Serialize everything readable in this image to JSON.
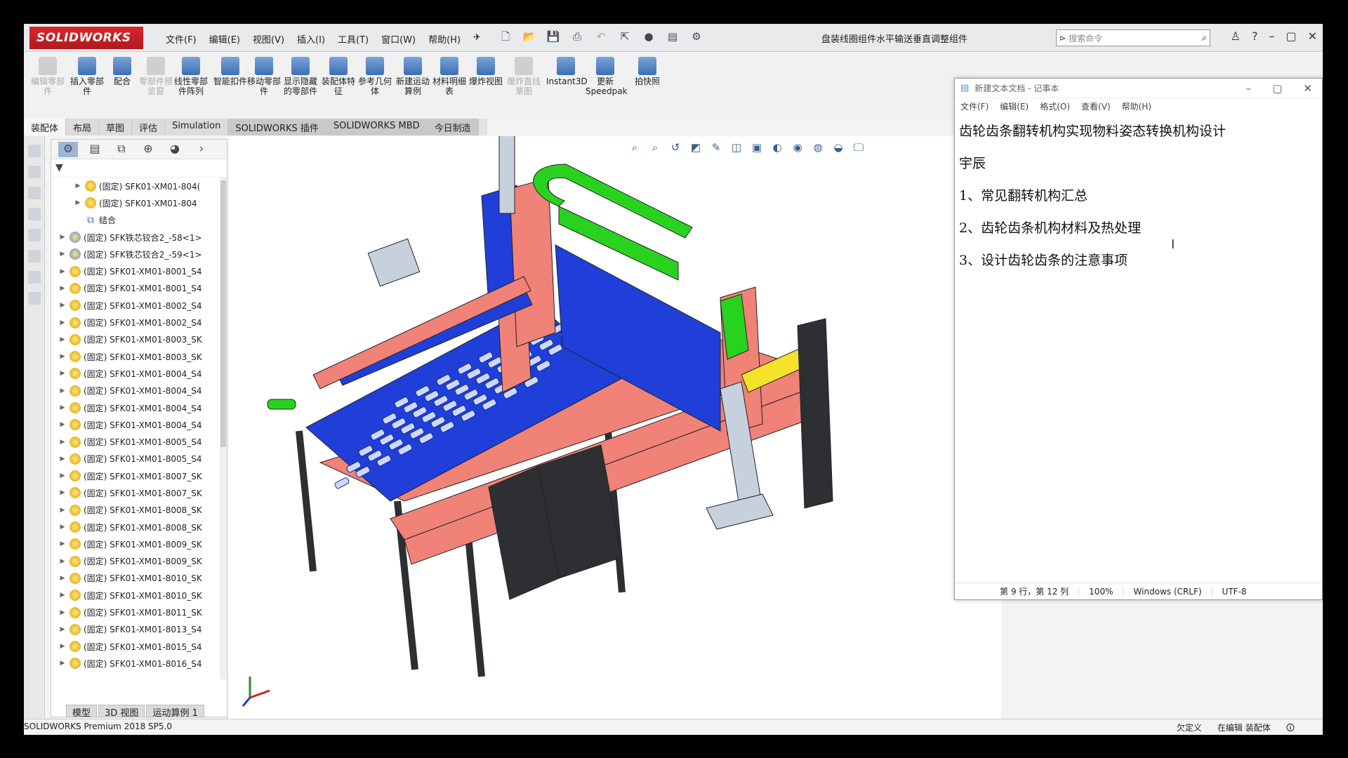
{
  "titlebar": {
    "brand": "SOLIDWORKS",
    "menu": [
      "文件(F)",
      "编辑(E)",
      "视图(V)",
      "插入(I)",
      "工具(T)",
      "窗口(W)",
      "帮助(H)"
    ],
    "document_title": "盘装线圈组件水平输送垂直调整组件",
    "search_placeholder": "搜索命令"
  },
  "commands": [
    {
      "label": "编辑零部件",
      "enabled": false
    },
    {
      "label": "插入零部件",
      "enabled": true
    },
    {
      "label": "配合",
      "enabled": true
    },
    {
      "label": "零部件预览窗",
      "enabled": false
    },
    {
      "label": "线性零部件阵列",
      "enabled": true
    },
    {
      "label": "智能扣件",
      "enabled": true
    },
    {
      "label": "移动零部件",
      "enabled": true
    },
    {
      "label": "显示隐藏的零部件",
      "enabled": true
    },
    {
      "label": "装配体特征",
      "enabled": true
    },
    {
      "label": "参考几何体",
      "enabled": true
    },
    {
      "label": "新建运动算例",
      "enabled": true
    },
    {
      "label": "材料明细表",
      "enabled": true
    },
    {
      "label": "爆炸视图",
      "enabled": true
    },
    {
      "label": "爆炸直线草图",
      "enabled": false
    },
    {
      "label": "Instant3D",
      "enabled": true
    },
    {
      "label": "更新Speedpak",
      "enabled": true
    },
    {
      "label": "拍快照",
      "enabled": true
    }
  ],
  "tabs": [
    "装配体",
    "布局",
    "草图",
    "评估",
    "Simulation",
    "SOLIDWORKS 插件",
    "SOLIDWORKS MBD",
    "今日制造"
  ],
  "tree": [
    {
      "label": "(固定) SFK01-XM01-804(",
      "indent": 2,
      "type": "part"
    },
    {
      "label": "(固定) SFK01-XM01-804",
      "indent": 2,
      "type": "part"
    },
    {
      "label": "结合",
      "indent": 2,
      "type": "mate"
    },
    {
      "label": "(固定) SFK铁芯铰合2_-58<1>",
      "indent": 1,
      "type": "asm"
    },
    {
      "label": "(固定) SFK铁芯铰合2_-59<1>",
      "indent": 1,
      "type": "asm"
    },
    {
      "label": "(固定) SFK01-XM01-8001_S4",
      "indent": 1,
      "type": "part"
    },
    {
      "label": "(固定) SFK01-XM01-8001_S4",
      "indent": 1,
      "type": "part"
    },
    {
      "label": "(固定) SFK01-XM01-8002_S4",
      "indent": 1,
      "type": "part"
    },
    {
      "label": "(固定) SFK01-XM01-8002_S4",
      "indent": 1,
      "type": "part"
    },
    {
      "label": "(固定) SFK01-XM01-8003_SK",
      "indent": 1,
      "type": "part"
    },
    {
      "label": "(固定) SFK01-XM01-8003_SK",
      "indent": 1,
      "type": "part"
    },
    {
      "label": "(固定) SFK01-XM01-8004_S4",
      "indent": 1,
      "type": "part"
    },
    {
      "label": "(固定) SFK01-XM01-8004_S4",
      "indent": 1,
      "type": "part"
    },
    {
      "label": "(固定) SFK01-XM01-8004_S4",
      "indent": 1,
      "type": "part"
    },
    {
      "label": "(固定) SFK01-XM01-8004_S4",
      "indent": 1,
      "type": "part"
    },
    {
      "label": "(固定) SFK01-XM01-8005_S4",
      "indent": 1,
      "type": "part"
    },
    {
      "label": "(固定) SFK01-XM01-8005_S4",
      "indent": 1,
      "type": "part"
    },
    {
      "label": "(固定) SFK01-XM01-8007_SK",
      "indent": 1,
      "type": "part"
    },
    {
      "label": "(固定) SFK01-XM01-8007_SK",
      "indent": 1,
      "type": "part"
    },
    {
      "label": "(固定) SFK01-XM01-8008_SK",
      "indent": 1,
      "type": "part"
    },
    {
      "label": "(固定) SFK01-XM01-8008_SK",
      "indent": 1,
      "type": "part"
    },
    {
      "label": "(固定) SFK01-XM01-8009_SK",
      "indent": 1,
      "type": "part"
    },
    {
      "label": "(固定) SFK01-XM01-8009_SK",
      "indent": 1,
      "type": "part"
    },
    {
      "label": "(固定) SFK01-XM01-8010_SK",
      "indent": 1,
      "type": "part"
    },
    {
      "label": "(固定) SFK01-XM01-8010_SK",
      "indent": 1,
      "type": "part"
    },
    {
      "label": "(固定) SFK01-XM01-8011_SK",
      "indent": 1,
      "type": "part"
    },
    {
      "label": "(固定) SFK01-XM01-8013_S4",
      "indent": 1,
      "type": "part"
    },
    {
      "label": "(固定) SFK01-XM01-8015_S4",
      "indent": 1,
      "type": "part"
    },
    {
      "label": "(固定) SFK01-XM01-8016_S4",
      "indent": 1,
      "type": "part"
    }
  ],
  "bottom_tabs": [
    "模型",
    "3D 视图",
    "运动算例 1"
  ],
  "status": {
    "product": "SOLIDWORKS Premium 2018 SP5.0",
    "defined": "欠定义",
    "editing": "在编辑 装配体"
  },
  "notepad": {
    "title": "新建文本文档 - 记事本",
    "menu": [
      "文件(F)",
      "编辑(E)",
      "格式(O)",
      "查看(V)",
      "帮助(H)"
    ],
    "lines": [
      "齿轮齿条翻转机构实现物料姿态转换机构设计",
      "宇辰",
      "1、常见翻转机构汇总",
      "2、齿轮齿条机构材料及热处理",
      "3、设计齿轮齿条的注意事项"
    ],
    "status": {
      "position": "第 9 行，第 12 列",
      "zoom": "100%",
      "eol": "Windows (CRLF)",
      "encoding": "UTF-8"
    }
  },
  "colors": {
    "salmon": "#f08278",
    "blue": "#1f3fd8",
    "green": "#29d21f",
    "yellow": "#f5e32b",
    "steel": "#c7d1de",
    "dark": "#2d2f33"
  }
}
